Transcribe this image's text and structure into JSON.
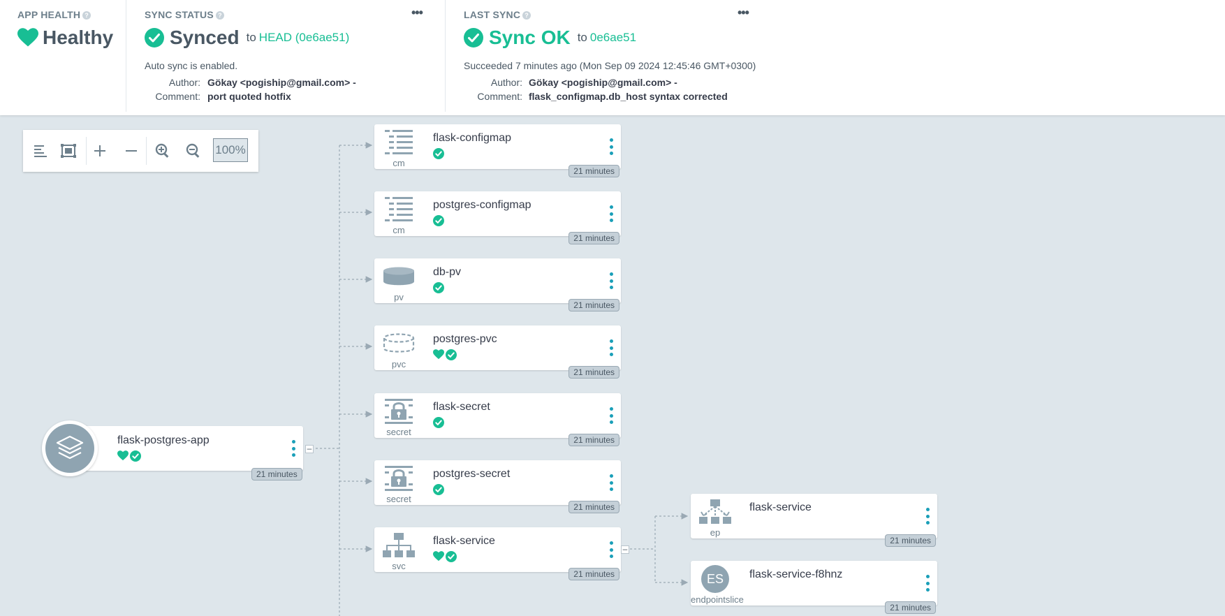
{
  "app_health": {
    "title": "APP HEALTH",
    "status": "Healthy",
    "status_color": "#18be94"
  },
  "sync_status": {
    "title": "SYNC STATUS",
    "status": "Synced",
    "to_label": "to",
    "revision": "HEAD (0e6ae51)",
    "auto_sync": "Auto sync is enabled.",
    "author_label": "Author:",
    "author": "Gökay <pogiship@gmail.com> -",
    "comment_label": "Comment:",
    "comment": "port quoted hotfix"
  },
  "last_sync": {
    "title": "LAST SYNC",
    "status": "Sync OK",
    "to_label": "to",
    "revision": "0e6ae51",
    "succeeded": "Succeeded 7 minutes ago (Mon Sep 09 2024 12:45:46 GMT+0300)",
    "author_label": "Author:",
    "author": "Gökay <pogiship@gmail.com> -",
    "comment_label": "Comment:",
    "comment": "flask_configmap.db_host syntax corrected"
  },
  "more_label": "•••",
  "toolbar": {
    "zoom": "100%",
    "icons": [
      "list-view-icon",
      "fit-view-icon",
      "expand-icon",
      "collapse-icon",
      "zoom-in-icon",
      "zoom-out-icon"
    ]
  },
  "app_node": {
    "name": "flask-postgres-app",
    "age": "21 minutes",
    "icon": "layers-icon"
  },
  "resources": [
    {
      "name": "flask-configmap",
      "kind": "cm",
      "icon": "configmap-icon",
      "healthy": false,
      "synced": true,
      "age": "21 minutes"
    },
    {
      "name": "postgres-configmap",
      "kind": "cm",
      "icon": "configmap-icon",
      "healthy": false,
      "synced": true,
      "age": "21 minutes"
    },
    {
      "name": "db-pv",
      "kind": "pv",
      "icon": "volume-icon",
      "healthy": false,
      "synced": true,
      "age": "21 minutes"
    },
    {
      "name": "postgres-pvc",
      "kind": "pvc",
      "icon": "volume-claim-icon",
      "healthy": true,
      "synced": true,
      "age": "21 minutes"
    },
    {
      "name": "flask-secret",
      "kind": "secret",
      "icon": "secret-icon",
      "healthy": false,
      "synced": true,
      "age": "21 minutes"
    },
    {
      "name": "postgres-secret",
      "kind": "secret",
      "icon": "secret-icon",
      "healthy": false,
      "synced": true,
      "age": "21 minutes"
    },
    {
      "name": "flask-service",
      "kind": "svc",
      "icon": "service-icon",
      "healthy": true,
      "synced": true,
      "age": "21 minutes"
    }
  ],
  "children": [
    {
      "name": "flask-service",
      "kind": "ep",
      "icon": "endpoints-icon",
      "age": "21 minutes"
    },
    {
      "name": "flask-service-f8hnz",
      "kind": "endpointslice",
      "icon": "endpointslice-icon",
      "badge": "ES",
      "age": "21 minutes"
    }
  ],
  "colors": {
    "accent": "#18be94",
    "menu_dots": "#1a9fb8",
    "canvas": "#dee6eb",
    "icon_gray": "#8fa4b1"
  }
}
